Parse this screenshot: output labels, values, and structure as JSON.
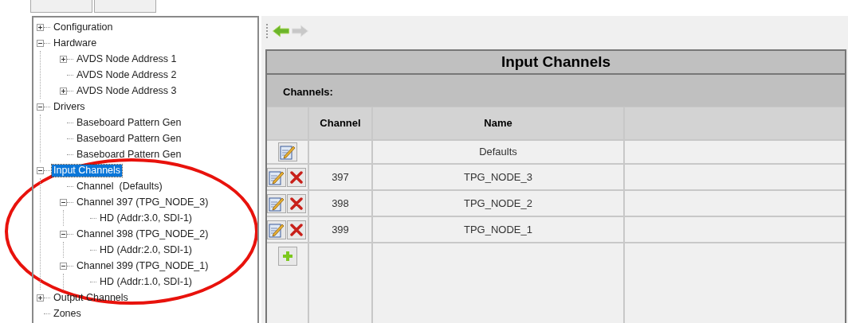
{
  "tree": [
    {
      "label": "Configuration",
      "expanded": false,
      "selected": false
    },
    {
      "label": "Hardware",
      "expanded": true,
      "selected": false,
      "children": [
        {
          "label": "AVDS Node Address 1",
          "expanded": false,
          "selected": false
        },
        {
          "label": "AVDS Node Address 2",
          "selected": false
        },
        {
          "label": "AVDS Node Address 3",
          "expanded": false,
          "selected": false
        }
      ]
    },
    {
      "label": "Drivers",
      "expanded": true,
      "selected": false,
      "children": [
        {
          "label": "Baseboard Pattern Gen",
          "selected": false
        },
        {
          "label": "Baseboard Pattern Gen",
          "selected": false
        },
        {
          "label": "Baseboard Pattern Gen",
          "selected": false
        }
      ]
    },
    {
      "label": "Input Channels",
      "expanded": true,
      "selected": true,
      "children": [
        {
          "label": "Channel  (Defaults)",
          "selected": false
        },
        {
          "label": "Channel 397 (TPG_NODE_3)",
          "expanded": true,
          "selected": false,
          "children": [
            {
              "label": "HD (Addr:3.0, SDI-1)",
              "selected": false
            }
          ]
        },
        {
          "label": "Channel 398 (TPG_NODE_2)",
          "expanded": true,
          "selected": false,
          "children": [
            {
              "label": "HD (Addr:2.0, SDI-1)",
              "selected": false
            }
          ]
        },
        {
          "label": "Channel 399 (TPG_NODE_1)",
          "expanded": true,
          "selected": false,
          "children": [
            {
              "label": "HD (Addr:1.0, SDI-1)",
              "selected": false
            }
          ]
        }
      ]
    },
    {
      "label": "Output Channels",
      "expanded": false,
      "selected": false
    },
    {
      "label": "Zones",
      "selected": false
    }
  ],
  "toolbar": [
    {
      "kind": "back",
      "disabled": false
    },
    {
      "kind": "forward",
      "disabled": true
    }
  ],
  "panel": {
    "title": "Input Channels",
    "section_label": "Channels:",
    "columns": [
      {
        "label": "Channel"
      },
      {
        "label": "Name"
      }
    ],
    "rows": [
      {
        "name": "Defaults",
        "deletable": false
      },
      {
        "channel": "397",
        "name": "TPG_NODE_3",
        "deletable": true
      },
      {
        "channel": "398",
        "name": "TPG_NODE_2",
        "deletable": true
      },
      {
        "channel": "399",
        "name": "TPG_NODE_1",
        "deletable": true
      }
    ],
    "add_row": true
  },
  "highlight_ellipse": true
}
